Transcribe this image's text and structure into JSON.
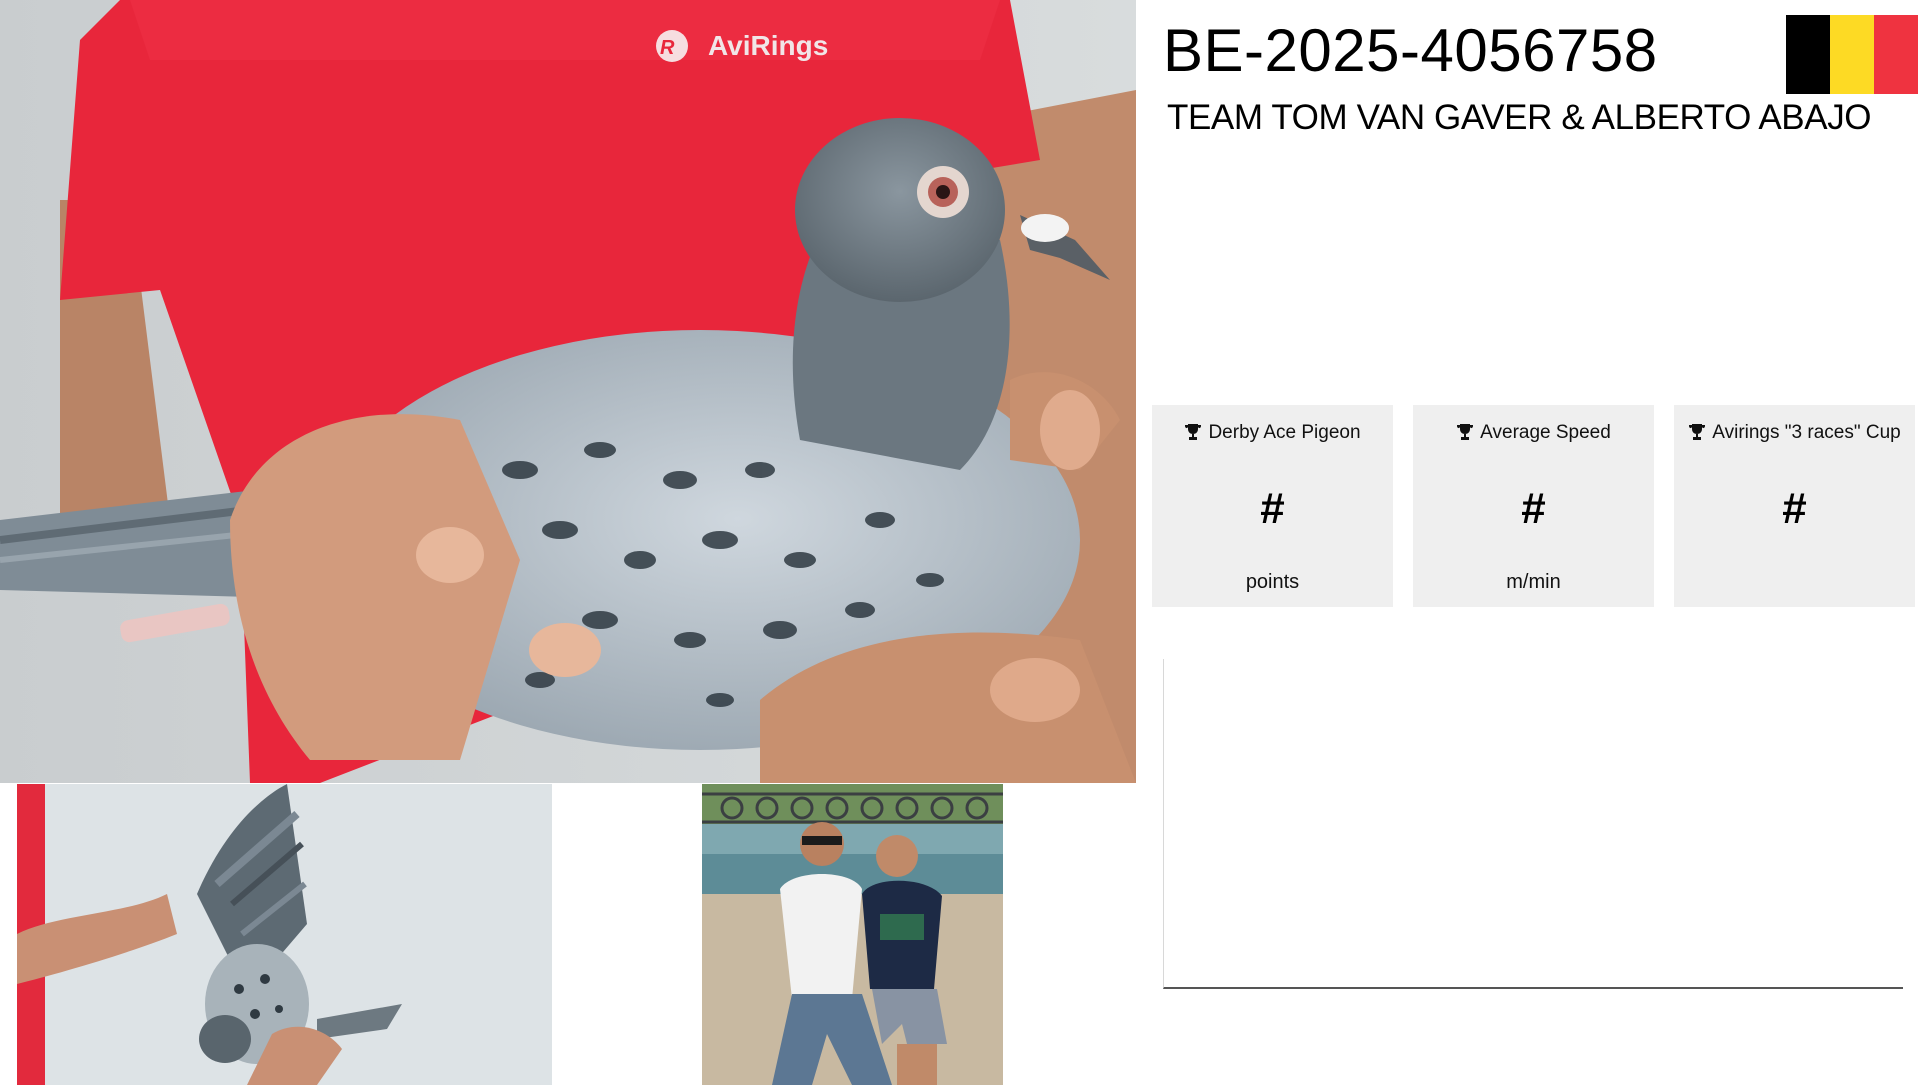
{
  "pigeon": {
    "ring_number": "BE-2025-4056758",
    "team": "TEAM TOM VAN GAVER & ALBERTO ABAJO",
    "country_flag": {
      "name": "belgium-flag-icon",
      "colors": [
        "#000000",
        "#FDDA24",
        "#EF3340"
      ]
    }
  },
  "photos": {
    "main": {
      "shirt_brand": "AviRings"
    }
  },
  "stats": [
    {
      "title": "Derby Ace Pigeon",
      "value": "#",
      "unit": "points",
      "icon": "trophy-icon"
    },
    {
      "title": "Average Speed",
      "value": "#",
      "unit": "m/min",
      "icon": "trophy-icon"
    },
    {
      "title": "Avirings \"3 races\" Cup",
      "value": "#",
      "unit": "",
      "icon": "trophy-icon"
    }
  ],
  "colors": {
    "card_background": "#efefef",
    "shirt_red": "#e8263b"
  }
}
